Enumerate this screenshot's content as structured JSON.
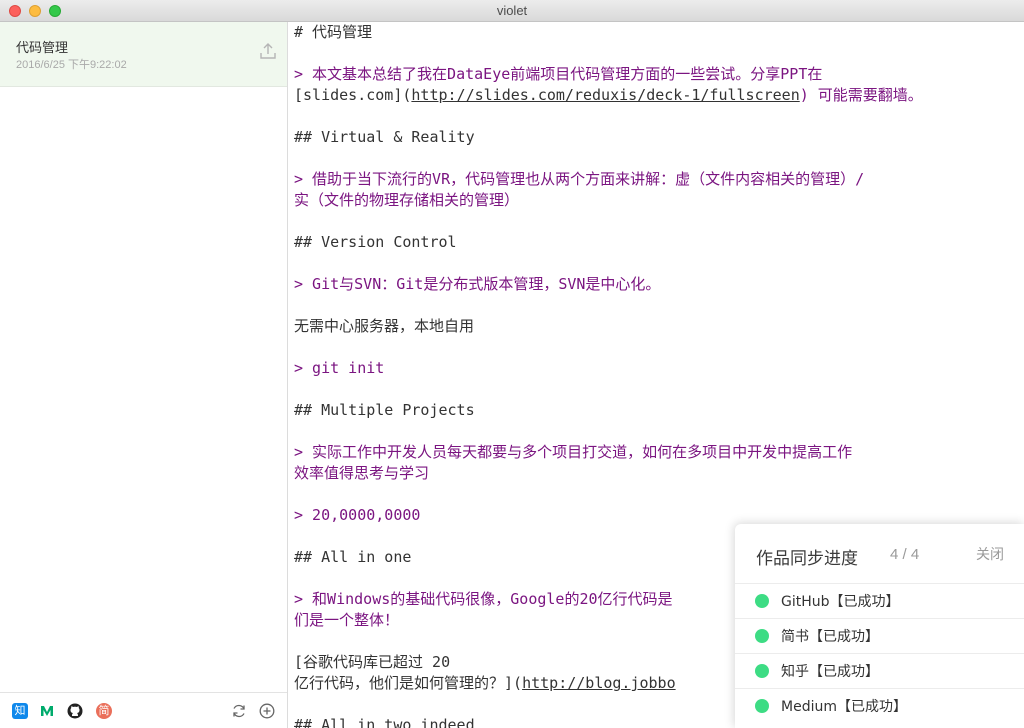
{
  "window": {
    "title": "violet"
  },
  "sidebar": {
    "note": {
      "title": "代码管理",
      "date": "2016/6/25 下午9:22:02"
    },
    "badges": {
      "zhihu": "知",
      "jianshu": "简"
    }
  },
  "editor": {
    "lines": {
      "l1": "# 代码管理",
      "l2": "> 本文基本总结了我在DataEye前端项目代码管理方面的一些尝试。分享PPT在",
      "l3a": "[slides.com](",
      "l3b": "http://slides.com/reduxis/deck-1/fullscreen",
      "l3c": ") 可能需要翻墙。",
      "l4": "## Virtual & Reality",
      "l5": "> 借助于当下流行的VR，代码管理也从两个方面来讲解：虚（文件内容相关的管理）/",
      "l6": "实（文件的物理存储相关的管理）",
      "l7": "## Version Control",
      "l8": "> Git与SVN：Git是分布式版本管理，SVN是中心化。",
      "l9": "无需中心服务器，本地自用",
      "l10": "> git init",
      "l11": "## Multiple Projects",
      "l12": "> 实际工作中开发人员每天都要与多个项目打交道，如何在多项目中开发中提高工作",
      "l13": "效率值得思考与学习",
      "l14": "> 20,0000,0000",
      "l15": "## All in one",
      "l16": "> 和Windows的基础代码很像，Google的20亿行代码是",
      "l17": "们是一个整体！",
      "l18": "[谷歌代码库已超过 20",
      "l19a": "亿行代码，他们是如何管理的？](",
      "l19b": "http://blog.jobbo",
      "l20": "## All in two indeed"
    }
  },
  "sync_panel": {
    "title": "作品同步进度",
    "count": "4 / 4",
    "close_label": "关闭",
    "status_color": "#3ddc84",
    "items": [
      {
        "label": "GitHub【已成功】"
      },
      {
        "label": "简书【已成功】"
      },
      {
        "label": "知乎【已成功】"
      },
      {
        "label": "Medium【已成功】"
      }
    ]
  }
}
